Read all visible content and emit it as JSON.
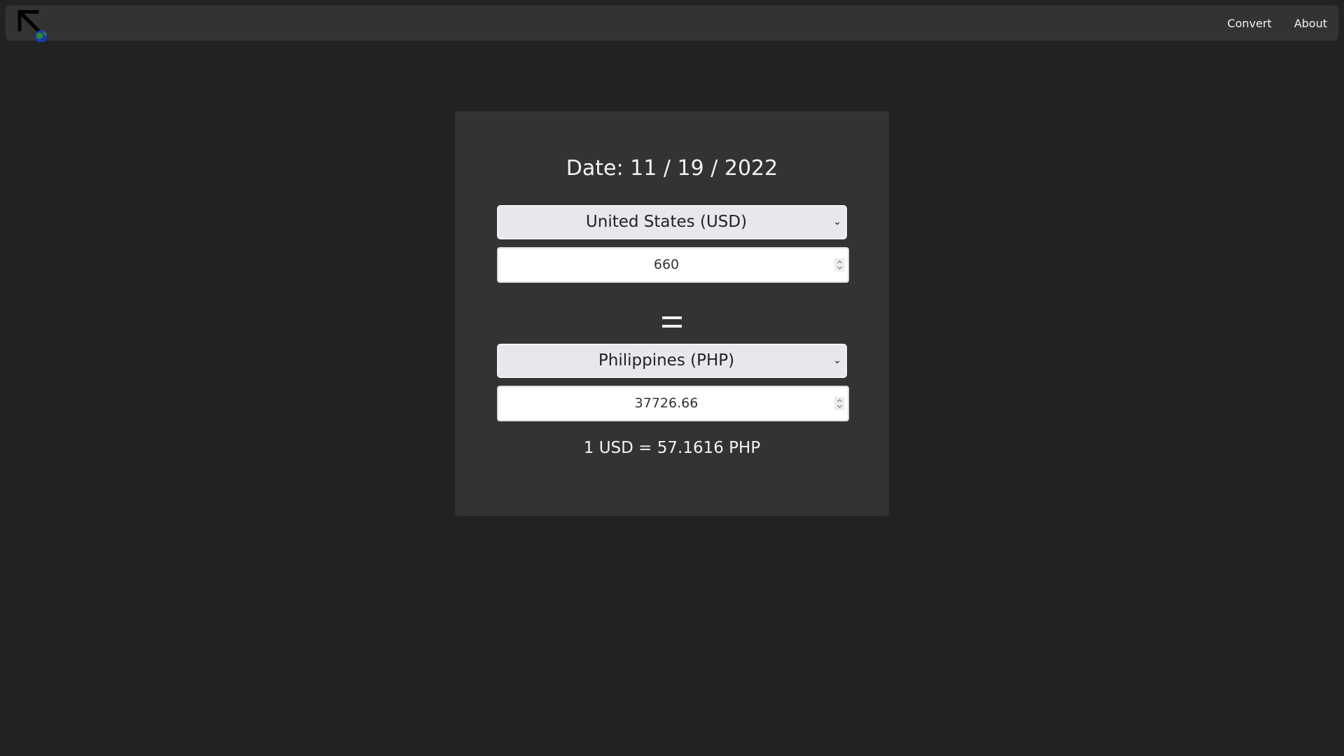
{
  "nav": {
    "logo_icon": "currency-globe-arrow-logo-icon",
    "links": [
      "Convert",
      "About"
    ]
  },
  "converter": {
    "date_label": "Date: 11 / 19 / 2022",
    "from": {
      "currency": "United States (USD)",
      "amount": "660"
    },
    "equals_icon": "equals-icon",
    "to": {
      "currency": "Philippines (PHP)",
      "amount": "37726.66"
    },
    "rate_text": "1 USD = 57.1616 PHP"
  },
  "colors": {
    "page_bg": "#222222",
    "panel_bg": "#333333",
    "text": "#f2f2f2",
    "select_bg": "#e8e8ec"
  }
}
